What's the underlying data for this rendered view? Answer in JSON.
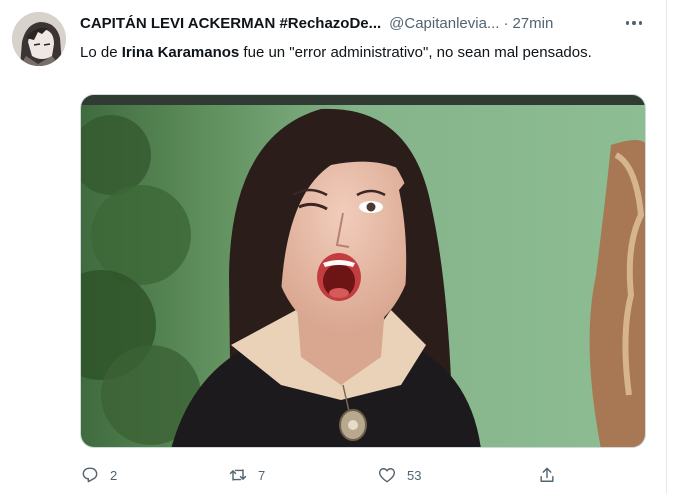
{
  "tweet": {
    "display_name": "CAPITÁN LEVI ACKERMAN #RechazoDe...",
    "handle": "@Capitanlevia...",
    "separator": "·",
    "time": "27min",
    "text_before": "Lo de ",
    "text_bold": "Irina Karamanos",
    "text_after": " fue un \"error administrativo\", no sean mal pensados."
  },
  "actions": {
    "reply_count": "2",
    "retweet_count": "7",
    "like_count": "53"
  },
  "icons": {
    "more": "more-horizontal-icon",
    "reply": "reply-icon",
    "retweet": "retweet-icon",
    "like": "heart-icon",
    "share": "share-icon"
  },
  "colors": {
    "text": "#0f1419",
    "secondary": "#536471",
    "border": "#cfd9de"
  }
}
